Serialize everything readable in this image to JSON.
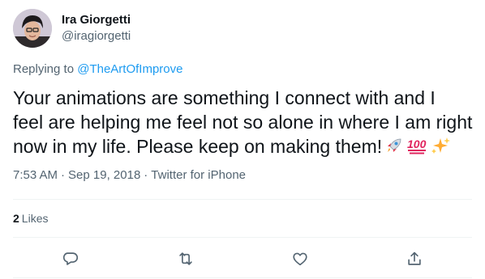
{
  "tweet": {
    "author": {
      "display_name": "Ira Giorgetti",
      "handle": "@iragiorgetti"
    },
    "replying_to": {
      "prefix": "Replying to",
      "mention": "@TheArtOfImprove"
    },
    "text_lines": [
      "Your animations are something I connect with and I",
      "feel are helping me feel not so alone in where I am right",
      "now in my life. Please keep on making them!"
    ],
    "emojis": [
      "rocket-emoji",
      "hundred-points-emoji",
      "sparkles-emoji"
    ],
    "meta": {
      "time": "7:53 AM",
      "date": "Sep 19, 2018",
      "source": "Twitter for iPhone",
      "separator": "·"
    },
    "likes": {
      "count": "2",
      "label": "Likes"
    },
    "actions": {
      "reply_icon": "reply-icon",
      "retweet_icon": "retweet-icon",
      "like_icon": "heart-icon",
      "share_icon": "share-icon"
    },
    "colors": {
      "link": "#1d9bf0",
      "secondary_text": "#536471",
      "primary_text": "#0f1419"
    }
  }
}
